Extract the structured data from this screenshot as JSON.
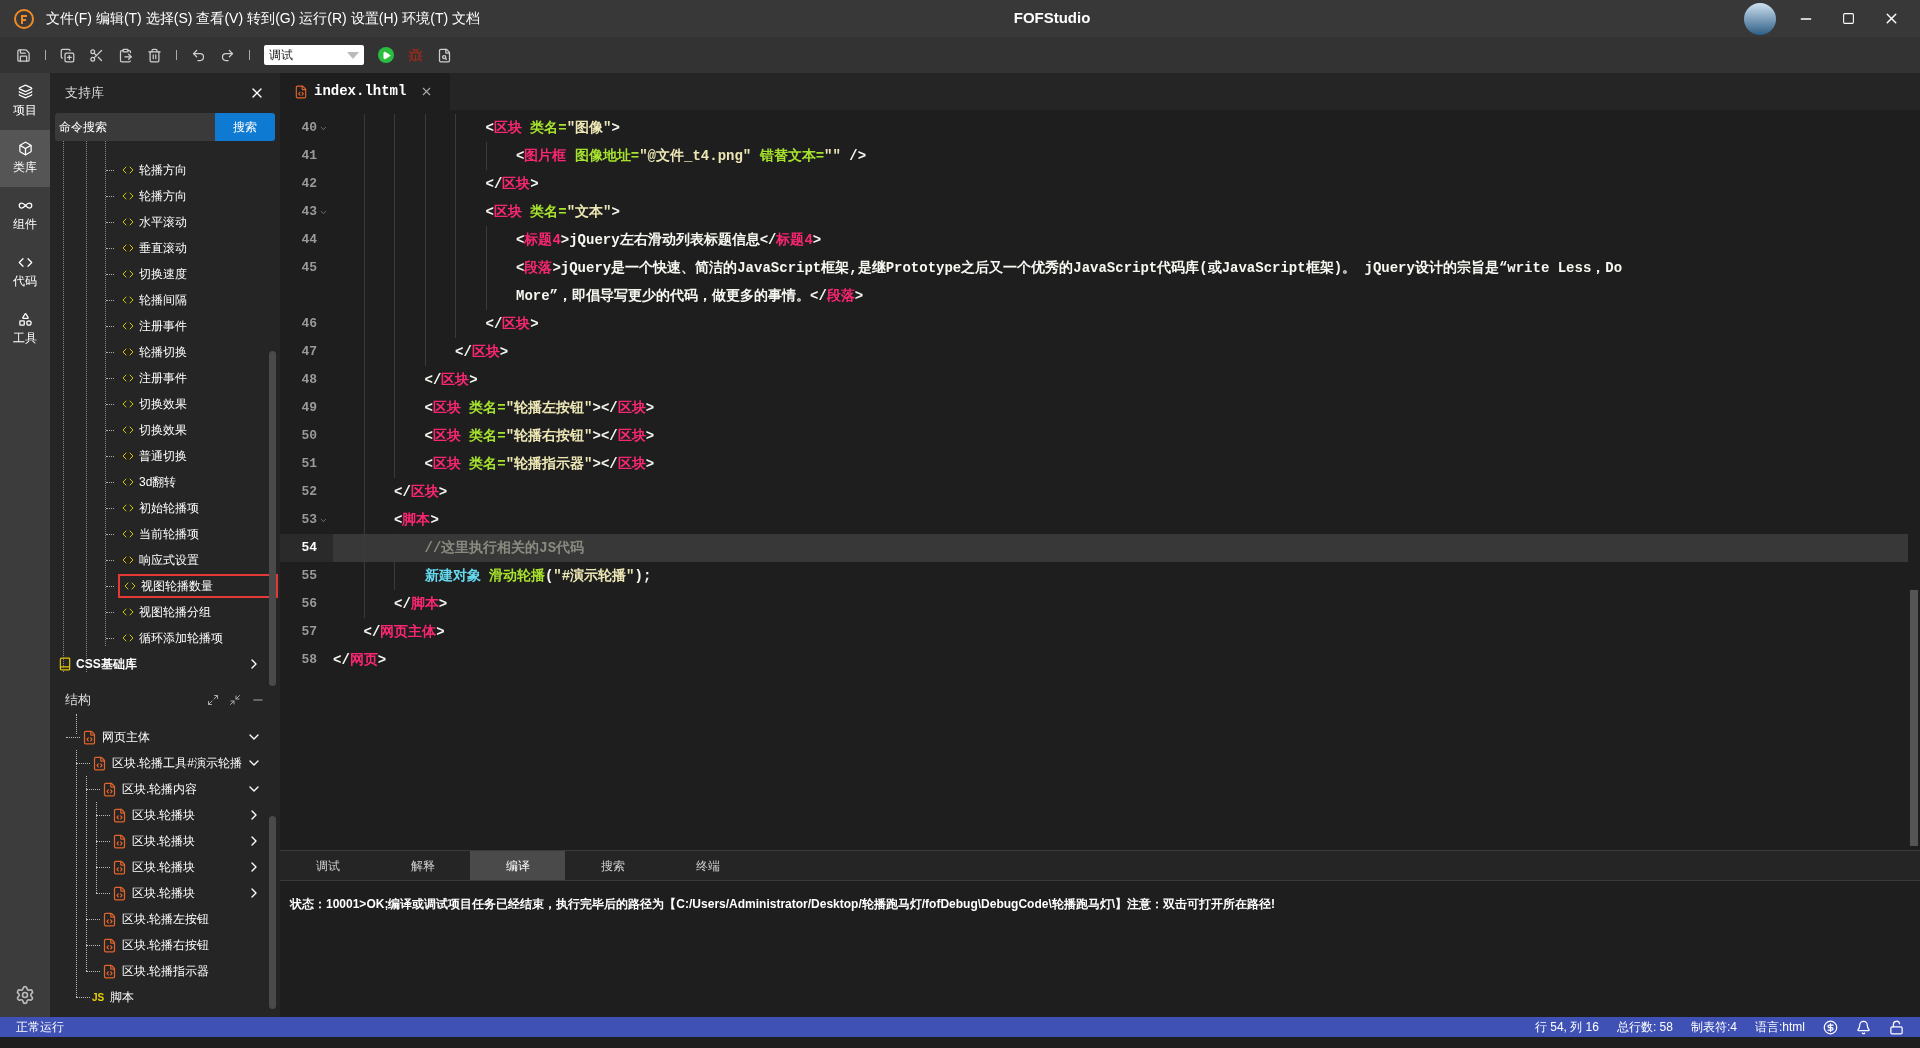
{
  "window": {
    "title": "FOFStudio"
  },
  "menu": [
    "文件(F)",
    "编辑(T)",
    "选择(S)",
    "查看(V)",
    "转到(G)",
    "运行(R)",
    "设置(H)",
    "环境(T)",
    "文档"
  ],
  "toolbar": {
    "mode": "调试"
  },
  "activity_bar": [
    {
      "label": "项目",
      "kind": "layers",
      "selected": false
    },
    {
      "label": "类库",
      "kind": "box",
      "selected": true
    },
    {
      "label": "组件",
      "kind": "link",
      "selected": false
    },
    {
      "label": "代码",
      "kind": "code",
      "selected": false
    },
    {
      "label": "工具",
      "kind": "tools",
      "selected": false
    }
  ],
  "library": {
    "title": "支持库",
    "search": {
      "placeholder": "命令搜索",
      "button": "搜索"
    },
    "items": [
      {
        "label": "轮播方向",
        "selected": false
      },
      {
        "label": "轮播方向",
        "selected": false
      },
      {
        "label": "水平滚动",
        "selected": false
      },
      {
        "label": "垂直滚动",
        "selected": false
      },
      {
        "label": "切换速度",
        "selected": false
      },
      {
        "label": "轮播间隔",
        "selected": false
      },
      {
        "label": "注册事件",
        "selected": false
      },
      {
        "label": "轮播切换",
        "selected": false
      },
      {
        "label": "注册事件",
        "selected": false
      },
      {
        "label": "切换效果",
        "selected": false
      },
      {
        "label": "切换效果",
        "selected": false
      },
      {
        "label": "普通切换",
        "selected": false
      },
      {
        "label": "3d翻转",
        "selected": false
      },
      {
        "label": "初始轮播项",
        "selected": false
      },
      {
        "label": "当前轮播项",
        "selected": false
      },
      {
        "label": "响应式设置",
        "selected": false
      },
      {
        "label": "视图轮播数量",
        "selected": true
      },
      {
        "label": "视图轮播分组",
        "selected": false
      },
      {
        "label": "循环添加轮播项",
        "selected": false
      }
    ],
    "group": {
      "label": "CSS基础库",
      "expanded": false
    }
  },
  "structure": {
    "title": "结构",
    "tree": [
      {
        "label": "网页主体",
        "kind": "html",
        "expanded": true,
        "children": [
          {
            "label": "区块.轮播工具#演示轮播",
            "kind": "html",
            "expanded": true,
            "children": [
              {
                "label": "区块.轮播内容",
                "kind": "html",
                "expanded": true,
                "children": [
                  {
                    "label": "区块.轮播块",
                    "kind": "html",
                    "expanded": false
                  },
                  {
                    "label": "区块.轮播块",
                    "kind": "html",
                    "expanded": false
                  },
                  {
                    "label": "区块.轮播块",
                    "kind": "html",
                    "expanded": false
                  },
                  {
                    "label": "区块.轮播块",
                    "kind": "html",
                    "expanded": false
                  }
                ]
              },
              {
                "label": "区块.轮播左按钮",
                "kind": "html"
              },
              {
                "label": "区块.轮播右按钮",
                "kind": "html"
              },
              {
                "label": "区块.轮播指示器",
                "kind": "html"
              }
            ]
          },
          {
            "label": "脚本",
            "kind": "js",
            "badge": "JS"
          }
        ]
      }
    ]
  },
  "editor": {
    "tabs": [
      {
        "label": "index.lhtml",
        "selected": true
      }
    ],
    "lines": [
      {
        "children": [
          {
            "children": [
              {
                "children": [
                  {
                    "children": [
                      {
                        "children": [
                          {
                            "number": "40",
                            "fold": true,
                            "current": false,
                            "tokens": [
                              {
                                "kind": "punct",
                                "text": "<"
                              },
                              {
                                "kind": "tag",
                                "text": "区块"
                              },
                              {
                                "kind": "attr",
                                "text": " 类名="
                              },
                              {
                                "kind": "string",
                                "text": "\"图像\""
                              },
                              {
                                "kind": "punct",
                                "text": ">"
                              }
                            ],
                            "children": [
                              {
                                "number": "41",
                                "fold": false,
                                "current": false,
                                "tokens": [
                                  {
                                    "kind": "punct",
                                    "text": "<"
                                  },
                                  {
                                    "kind": "tag",
                                    "text": "图片框"
                                  },
                                  {
                                    "kind": "attr",
                                    "text": " 图像地址="
                                  },
                                  {
                                    "kind": "string",
                                    "text": "\"@文件_t4.png\""
                                  },
                                  {
                                    "kind": "attr",
                                    "text": " 错替文本="
                                  },
                                  {
                                    "kind": "string",
                                    "text": "\"\""
                                  },
                                  {
                                    "kind": "punct",
                                    "text": " />"
                                  }
                                ]
                              }
                            ]
                          },
                          {
                            "number": "42",
                            "fold": false,
                            "current": false,
                            "tokens": [
                              {
                                "kind": "punct",
                                "text": "</"
                              },
                              {
                                "kind": "tag",
                                "text": "区块"
                              },
                              {
                                "kind": "punct",
                                "text": ">"
                              }
                            ]
                          },
                          {
                            "number": "43",
                            "fold": true,
                            "current": false,
                            "tokens": [
                              {
                                "kind": "punct",
                                "text": "<"
                              },
                              {
                                "kind": "tag",
                                "text": "区块"
                              },
                              {
                                "kind": "attr",
                                "text": " 类名="
                              },
                              {
                                "kind": "string",
                                "text": "\"文本\""
                              },
                              {
                                "kind": "punct",
                                "text": ">"
                              }
                            ],
                            "children": [
                              {
                                "number": "44",
                                "fold": false,
                                "current": false,
                                "tokens": [
                                  {
                                    "kind": "punct",
                                    "text": "<"
                                  },
                                  {
                                    "kind": "tag",
                                    "text": "标题4"
                                  },
                                  {
                                    "kind": "punct",
                                    "text": ">"
                                  },
                                  {
                                    "kind": "text",
                                    "text": "jQuery左右滑动列表标题信息"
                                  },
                                  {
                                    "kind": "punct",
                                    "text": "</"
                                  },
                                  {
                                    "kind": "tag",
                                    "text": "标题4"
                                  },
                                  {
                                    "kind": "punct",
                                    "text": ">"
                                  }
                                ]
                              },
                              {
                                "number": "45",
                                "fold": false,
                                "current": false,
                                "tokens": [
                                  {
                                    "kind": "punct",
                                    "text": "<"
                                  },
                                  {
                                    "kind": "tag",
                                    "text": "段落"
                                  },
                                  {
                                    "kind": "punct",
                                    "text": ">"
                                  },
                                  {
                                    "kind": "text",
                                    "text": "jQuery是一个快速、简洁的JavaScript框架,是继Prototype之后又一个优秀的JavaScript代码库(或JavaScript框架)。 jQuery设计的宗旨是“write Less，Do"
                                  }
                                ],
                                "wrap": [
                                  {
                                    "kind": "text",
                                    "text": "More”，即倡导写更少的代码，做更多的事情。"
                                  },
                                  {
                                    "kind": "punct",
                                    "text": "</"
                                  },
                                  {
                                    "kind": "tag",
                                    "text": "段落"
                                  },
                                  {
                                    "kind": "punct",
                                    "text": ">"
                                  }
                                ]
                              }
                            ]
                          },
                          {
                            "number": "46",
                            "fold": false,
                            "current": false,
                            "tokens": [
                              {
                                "kind": "punct",
                                "text": "</"
                              },
                              {
                                "kind": "tag",
                                "text": "区块"
                              },
                              {
                                "kind": "punct",
                                "text": ">"
                              }
                            ]
                          }
                        ]
                      },
                      {
                        "number": "47",
                        "fold": false,
                        "current": false,
                        "tokens": [
                          {
                            "kind": "punct",
                            "text": "</"
                          },
                          {
                            "kind": "tag",
                            "text": "区块"
                          },
                          {
                            "kind": "punct",
                            "text": ">"
                          }
                        ]
                      }
                    ]
                  },
                  {
                    "number": "48",
                    "fold": false,
                    "current": false,
                    "tokens": [
                      {
                        "kind": "punct",
                        "text": "</"
                      },
                      {
                        "kind": "tag",
                        "text": "区块"
                      },
                      {
                        "kind": "punct",
                        "text": ">"
                      }
                    ]
                  },
                  {
                    "number": "49",
                    "fold": false,
                    "current": false,
                    "tokens": [
                      {
                        "kind": "punct",
                        "text": "<"
                      },
                      {
                        "kind": "tag",
                        "text": "区块"
                      },
                      {
                        "kind": "attr",
                        "text": " 类名="
                      },
                      {
                        "kind": "string",
                        "text": "\"轮播左按钮\""
                      },
                      {
                        "kind": "punct",
                        "text": "></"
                      },
                      {
                        "kind": "tag",
                        "text": "区块"
                      },
                      {
                        "kind": "punct",
                        "text": ">"
                      }
                    ]
                  },
                  {
                    "number": "50",
                    "fold": false,
                    "current": false,
                    "tokens": [
                      {
                        "kind": "punct",
                        "text": "<"
                      },
                      {
                        "kind": "tag",
                        "text": "区块"
                      },
                      {
                        "kind": "attr",
                        "text": " 类名="
                      },
                      {
                        "kind": "string",
                        "text": "\"轮播右按钮\""
                      },
                      {
                        "kind": "punct",
                        "text": "></"
                      },
                      {
                        "kind": "tag",
                        "text": "区块"
                      },
                      {
                        "kind": "punct",
                        "text": ">"
                      }
                    ]
                  },
                  {
                    "number": "51",
                    "fold": false,
                    "current": false,
                    "tokens": [
                      {
                        "kind": "punct",
                        "text": "<"
                      },
                      {
                        "kind": "tag",
                        "text": "区块"
                      },
                      {
                        "kind": "attr",
                        "text": " 类名="
                      },
                      {
                        "kind": "string",
                        "text": "\"轮播指示器\""
                      },
                      {
                        "kind": "punct",
                        "text": "></"
                      },
                      {
                        "kind": "tag",
                        "text": "区块"
                      },
                      {
                        "kind": "punct",
                        "text": ">"
                      }
                    ]
                  }
                ]
              },
              {
                "number": "52",
                "fold": false,
                "current": false,
                "tokens": [
                  {
                    "kind": "punct",
                    "text": "</"
                  },
                  {
                    "kind": "tag",
                    "text": "区块"
                  },
                  {
                    "kind": "punct",
                    "text": ">"
                  }
                ]
              },
              {
                "number": "53",
                "fold": true,
                "current": false,
                "tokens": [
                  {
                    "kind": "punct",
                    "text": "<"
                  },
                  {
                    "kind": "tag",
                    "text": "脚本"
                  },
                  {
                    "kind": "punct",
                    "text": ">"
                  }
                ],
                "children": [
                  {
                    "number": "54",
                    "fold": false,
                    "current": true,
                    "tokens": [
                      {
                        "kind": "comment",
                        "text": "//这里执行相关的JS代码"
                      }
                    ]
                  },
                  {
                    "number": "55",
                    "fold": false,
                    "current": false,
                    "tokens": [
                      {
                        "kind": "func",
                        "text": "新建对象"
                      },
                      {
                        "kind": "call",
                        "text": " 滑动轮播"
                      },
                      {
                        "kind": "punct",
                        "text": "("
                      },
                      {
                        "kind": "string",
                        "text": "\"#演示轮播\""
                      },
                      {
                        "kind": "punct",
                        "text": ");"
                      }
                    ]
                  }
                ]
              },
              {
                "number": "56",
                "fold": false,
                "current": false,
                "tokens": [
                  {
                    "kind": "punct",
                    "text": "</"
                  },
                  {
                    "kind": "tag",
                    "text": "脚本"
                  },
                  {
                    "kind": "punct",
                    "text": ">"
                  }
                ]
              }
            ]
          },
          {
            "number": "57",
            "fold": false,
            "current": false,
            "tokens": [
              {
                "kind": "punct",
                "text": "</"
              },
              {
                "kind": "tag",
                "text": "网页主体"
              },
              {
                "kind": "punct",
                "text": ">"
              }
            ]
          }
        ]
      },
      {
        "number": "58",
        "fold": false,
        "current": false,
        "tokens": [
          {
            "kind": "punct",
            "text": "</"
          },
          {
            "kind": "tag",
            "text": "网页"
          },
          {
            "kind": "punct",
            "text": ">"
          }
        ]
      }
    ]
  },
  "output": {
    "tabs": [
      {
        "label": "调试",
        "selected": false
      },
      {
        "label": "解释",
        "selected": false
      },
      {
        "label": "编译",
        "selected": true
      },
      {
        "label": "搜索",
        "selected": false
      },
      {
        "label": "终端",
        "selected": false
      }
    ],
    "message": "状态：10001>OK;编译或调试项目任务已经结束，执行完毕后的路径为【C:/Users/Administrator/Desktop/轮播跑马灯/fofDebug\\DebugCode\\轮播跑马灯\\】注意：双击可打开所在路径!"
  },
  "status_bar": {
    "left": "正常运行",
    "items": [
      "行 54, 列 16",
      "总行数: 58",
      "制表符:4",
      "语言:html"
    ]
  }
}
